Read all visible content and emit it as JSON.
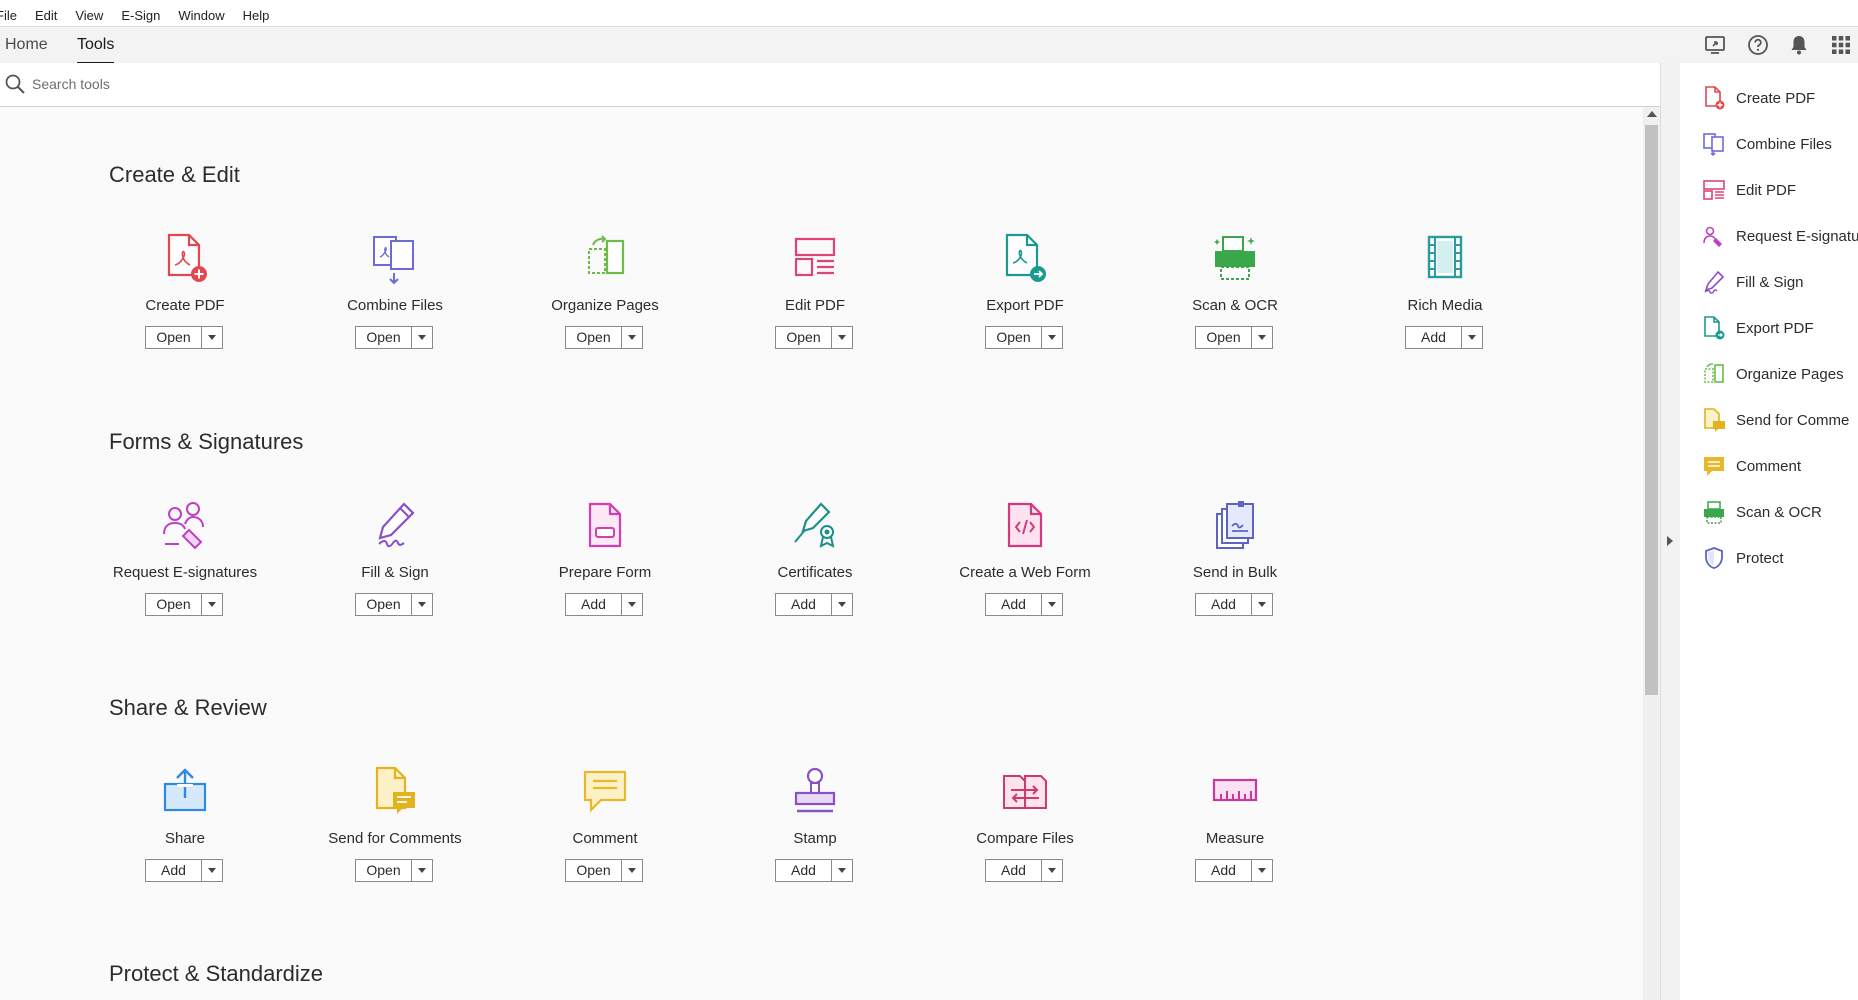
{
  "menu": [
    "File",
    "Edit",
    "View",
    "E-Sign",
    "Window",
    "Help"
  ],
  "tabs": {
    "home": "Home",
    "tools": "Tools"
  },
  "toolbar_icons": [
    "share-screen-icon",
    "help-icon",
    "notification-bell-icon",
    "apps-grid-icon"
  ],
  "search": {
    "placeholder": "Search tools",
    "value": ""
  },
  "sections": [
    {
      "title": "Create & Edit",
      "tools": [
        {
          "label": "Create PDF",
          "button": "Open",
          "icon": "create-pdf-icon",
          "color": "#e34850"
        },
        {
          "label": "Combine Files",
          "button": "Open",
          "icon": "combine-files-icon",
          "color": "#6b6cd8"
        },
        {
          "label": "Organize Pages",
          "button": "Open",
          "icon": "organize-pages-icon",
          "color": "#6dbb4a"
        },
        {
          "label": "Edit PDF",
          "button": "Open",
          "icon": "edit-pdf-icon",
          "color": "#e0427a"
        },
        {
          "label": "Export PDF",
          "button": "Open",
          "icon": "export-pdf-icon",
          "color": "#1d9a8f"
        },
        {
          "label": "Scan & OCR",
          "button": "Open",
          "icon": "scan-ocr-icon",
          "color": "#3aa84a"
        },
        {
          "label": "Rich Media",
          "button": "Add",
          "icon": "rich-media-icon",
          "color": "#2a9ca0"
        }
      ]
    },
    {
      "title": "Forms & Signatures",
      "tools": [
        {
          "label": "Request E-signatures",
          "button": "Open",
          "icon": "request-esignatures-icon",
          "color": "#c03fc4"
        },
        {
          "label": "Fill & Sign",
          "button": "Open",
          "icon": "fill-sign-icon",
          "color": "#8a4fc7"
        },
        {
          "label": "Prepare Form",
          "button": "Add",
          "icon": "prepare-form-icon",
          "color": "#d33fb0"
        },
        {
          "label": "Certificates",
          "button": "Add",
          "icon": "certificates-icon",
          "color": "#1d8f8a"
        },
        {
          "label": "Create a Web Form",
          "button": "Add",
          "icon": "create-web-form-icon",
          "color": "#d4387f"
        },
        {
          "label": "Send in Bulk",
          "button": "Add",
          "icon": "send-in-bulk-icon",
          "color": "#5b63c4"
        }
      ]
    },
    {
      "title": "Share & Review",
      "tools": [
        {
          "label": "Share",
          "button": "Add",
          "icon": "share-icon",
          "color": "#2d8ae0"
        },
        {
          "label": "Send for Comments",
          "button": "Open",
          "icon": "send-for-comments-icon",
          "color": "#e2b21f"
        },
        {
          "label": "Comment",
          "button": "Open",
          "icon": "comment-icon",
          "color": "#e6b82a"
        },
        {
          "label": "Stamp",
          "button": "Add",
          "icon": "stamp-icon",
          "color": "#8b4fc6"
        },
        {
          "label": "Compare Files",
          "button": "Add",
          "icon": "compare-files-icon",
          "color": "#d2386e"
        },
        {
          "label": "Measure",
          "button": "Add",
          "icon": "measure-icon",
          "color": "#c9389c"
        }
      ]
    },
    {
      "title": "Protect & Standardize",
      "tools": []
    }
  ],
  "right_pane": [
    {
      "label": "Create PDF",
      "icon": "create-pdf-icon",
      "color": "#e34850"
    },
    {
      "label": "Combine Files",
      "icon": "combine-files-icon",
      "color": "#6b6cd8"
    },
    {
      "label": "Edit PDF",
      "icon": "edit-pdf-icon",
      "color": "#e0427a"
    },
    {
      "label": "Request E-signatu",
      "icon": "request-esignatures-icon",
      "color": "#c03fc4"
    },
    {
      "label": "Fill & Sign",
      "icon": "fill-sign-icon",
      "color": "#8a4fc7"
    },
    {
      "label": "Export PDF",
      "icon": "export-pdf-icon",
      "color": "#1d9a8f"
    },
    {
      "label": "Organize Pages",
      "icon": "organize-pages-icon",
      "color": "#6dbb4a"
    },
    {
      "label": "Send for Comme",
      "icon": "send-for-comments-icon",
      "color": "#e2b21f"
    },
    {
      "label": "Comment",
      "icon": "comment-icon",
      "color": "#e6b82a"
    },
    {
      "label": "Scan & OCR",
      "icon": "scan-ocr-icon",
      "color": "#3aa84a"
    },
    {
      "label": "Protect",
      "icon": "protect-icon",
      "color": "#5b63c4"
    }
  ]
}
